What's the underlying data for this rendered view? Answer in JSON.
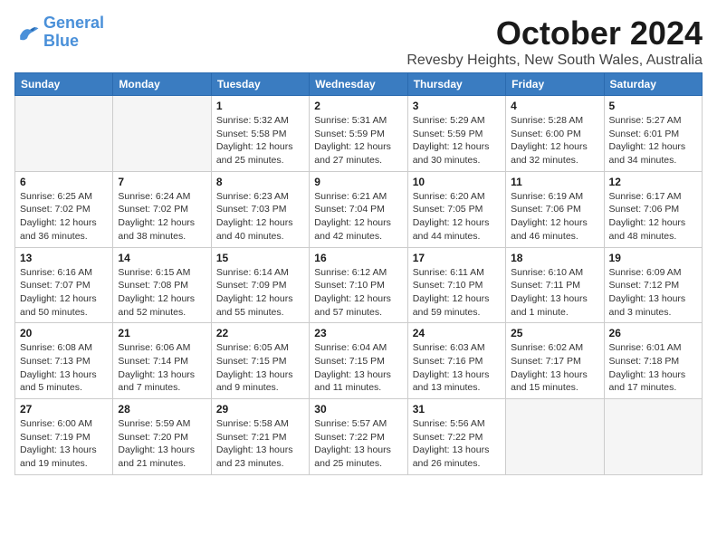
{
  "logo": {
    "line1": "General",
    "line2": "Blue"
  },
  "title": "October 2024",
  "location": "Revesby Heights, New South Wales, Australia",
  "days_of_week": [
    "Sunday",
    "Monday",
    "Tuesday",
    "Wednesday",
    "Thursday",
    "Friday",
    "Saturday"
  ],
  "weeks": [
    [
      {
        "day": "",
        "sunrise": "",
        "sunset": "",
        "daylight": ""
      },
      {
        "day": "",
        "sunrise": "",
        "sunset": "",
        "daylight": ""
      },
      {
        "day": "1",
        "sunrise": "Sunrise: 5:32 AM",
        "sunset": "Sunset: 5:58 PM",
        "daylight": "Daylight: 12 hours and 25 minutes."
      },
      {
        "day": "2",
        "sunrise": "Sunrise: 5:31 AM",
        "sunset": "Sunset: 5:59 PM",
        "daylight": "Daylight: 12 hours and 27 minutes."
      },
      {
        "day": "3",
        "sunrise": "Sunrise: 5:29 AM",
        "sunset": "Sunset: 5:59 PM",
        "daylight": "Daylight: 12 hours and 30 minutes."
      },
      {
        "day": "4",
        "sunrise": "Sunrise: 5:28 AM",
        "sunset": "Sunset: 6:00 PM",
        "daylight": "Daylight: 12 hours and 32 minutes."
      },
      {
        "day": "5",
        "sunrise": "Sunrise: 5:27 AM",
        "sunset": "Sunset: 6:01 PM",
        "daylight": "Daylight: 12 hours and 34 minutes."
      }
    ],
    [
      {
        "day": "6",
        "sunrise": "Sunrise: 6:25 AM",
        "sunset": "Sunset: 7:02 PM",
        "daylight": "Daylight: 12 hours and 36 minutes."
      },
      {
        "day": "7",
        "sunrise": "Sunrise: 6:24 AM",
        "sunset": "Sunset: 7:02 PM",
        "daylight": "Daylight: 12 hours and 38 minutes."
      },
      {
        "day": "8",
        "sunrise": "Sunrise: 6:23 AM",
        "sunset": "Sunset: 7:03 PM",
        "daylight": "Daylight: 12 hours and 40 minutes."
      },
      {
        "day": "9",
        "sunrise": "Sunrise: 6:21 AM",
        "sunset": "Sunset: 7:04 PM",
        "daylight": "Daylight: 12 hours and 42 minutes."
      },
      {
        "day": "10",
        "sunrise": "Sunrise: 6:20 AM",
        "sunset": "Sunset: 7:05 PM",
        "daylight": "Daylight: 12 hours and 44 minutes."
      },
      {
        "day": "11",
        "sunrise": "Sunrise: 6:19 AM",
        "sunset": "Sunset: 7:06 PM",
        "daylight": "Daylight: 12 hours and 46 minutes."
      },
      {
        "day": "12",
        "sunrise": "Sunrise: 6:17 AM",
        "sunset": "Sunset: 7:06 PM",
        "daylight": "Daylight: 12 hours and 48 minutes."
      }
    ],
    [
      {
        "day": "13",
        "sunrise": "Sunrise: 6:16 AM",
        "sunset": "Sunset: 7:07 PM",
        "daylight": "Daylight: 12 hours and 50 minutes."
      },
      {
        "day": "14",
        "sunrise": "Sunrise: 6:15 AM",
        "sunset": "Sunset: 7:08 PM",
        "daylight": "Daylight: 12 hours and 52 minutes."
      },
      {
        "day": "15",
        "sunrise": "Sunrise: 6:14 AM",
        "sunset": "Sunset: 7:09 PM",
        "daylight": "Daylight: 12 hours and 55 minutes."
      },
      {
        "day": "16",
        "sunrise": "Sunrise: 6:12 AM",
        "sunset": "Sunset: 7:10 PM",
        "daylight": "Daylight: 12 hours and 57 minutes."
      },
      {
        "day": "17",
        "sunrise": "Sunrise: 6:11 AM",
        "sunset": "Sunset: 7:10 PM",
        "daylight": "Daylight: 12 hours and 59 minutes."
      },
      {
        "day": "18",
        "sunrise": "Sunrise: 6:10 AM",
        "sunset": "Sunset: 7:11 PM",
        "daylight": "Daylight: 13 hours and 1 minute."
      },
      {
        "day": "19",
        "sunrise": "Sunrise: 6:09 AM",
        "sunset": "Sunset: 7:12 PM",
        "daylight": "Daylight: 13 hours and 3 minutes."
      }
    ],
    [
      {
        "day": "20",
        "sunrise": "Sunrise: 6:08 AM",
        "sunset": "Sunset: 7:13 PM",
        "daylight": "Daylight: 13 hours and 5 minutes."
      },
      {
        "day": "21",
        "sunrise": "Sunrise: 6:06 AM",
        "sunset": "Sunset: 7:14 PM",
        "daylight": "Daylight: 13 hours and 7 minutes."
      },
      {
        "day": "22",
        "sunrise": "Sunrise: 6:05 AM",
        "sunset": "Sunset: 7:15 PM",
        "daylight": "Daylight: 13 hours and 9 minutes."
      },
      {
        "day": "23",
        "sunrise": "Sunrise: 6:04 AM",
        "sunset": "Sunset: 7:15 PM",
        "daylight": "Daylight: 13 hours and 11 minutes."
      },
      {
        "day": "24",
        "sunrise": "Sunrise: 6:03 AM",
        "sunset": "Sunset: 7:16 PM",
        "daylight": "Daylight: 13 hours and 13 minutes."
      },
      {
        "day": "25",
        "sunrise": "Sunrise: 6:02 AM",
        "sunset": "Sunset: 7:17 PM",
        "daylight": "Daylight: 13 hours and 15 minutes."
      },
      {
        "day": "26",
        "sunrise": "Sunrise: 6:01 AM",
        "sunset": "Sunset: 7:18 PM",
        "daylight": "Daylight: 13 hours and 17 minutes."
      }
    ],
    [
      {
        "day": "27",
        "sunrise": "Sunrise: 6:00 AM",
        "sunset": "Sunset: 7:19 PM",
        "daylight": "Daylight: 13 hours and 19 minutes."
      },
      {
        "day": "28",
        "sunrise": "Sunrise: 5:59 AM",
        "sunset": "Sunset: 7:20 PM",
        "daylight": "Daylight: 13 hours and 21 minutes."
      },
      {
        "day": "29",
        "sunrise": "Sunrise: 5:58 AM",
        "sunset": "Sunset: 7:21 PM",
        "daylight": "Daylight: 13 hours and 23 minutes."
      },
      {
        "day": "30",
        "sunrise": "Sunrise: 5:57 AM",
        "sunset": "Sunset: 7:22 PM",
        "daylight": "Daylight: 13 hours and 25 minutes."
      },
      {
        "day": "31",
        "sunrise": "Sunrise: 5:56 AM",
        "sunset": "Sunset: 7:22 PM",
        "daylight": "Daylight: 13 hours and 26 minutes."
      },
      {
        "day": "",
        "sunrise": "",
        "sunset": "",
        "daylight": ""
      },
      {
        "day": "",
        "sunrise": "",
        "sunset": "",
        "daylight": ""
      }
    ]
  ]
}
